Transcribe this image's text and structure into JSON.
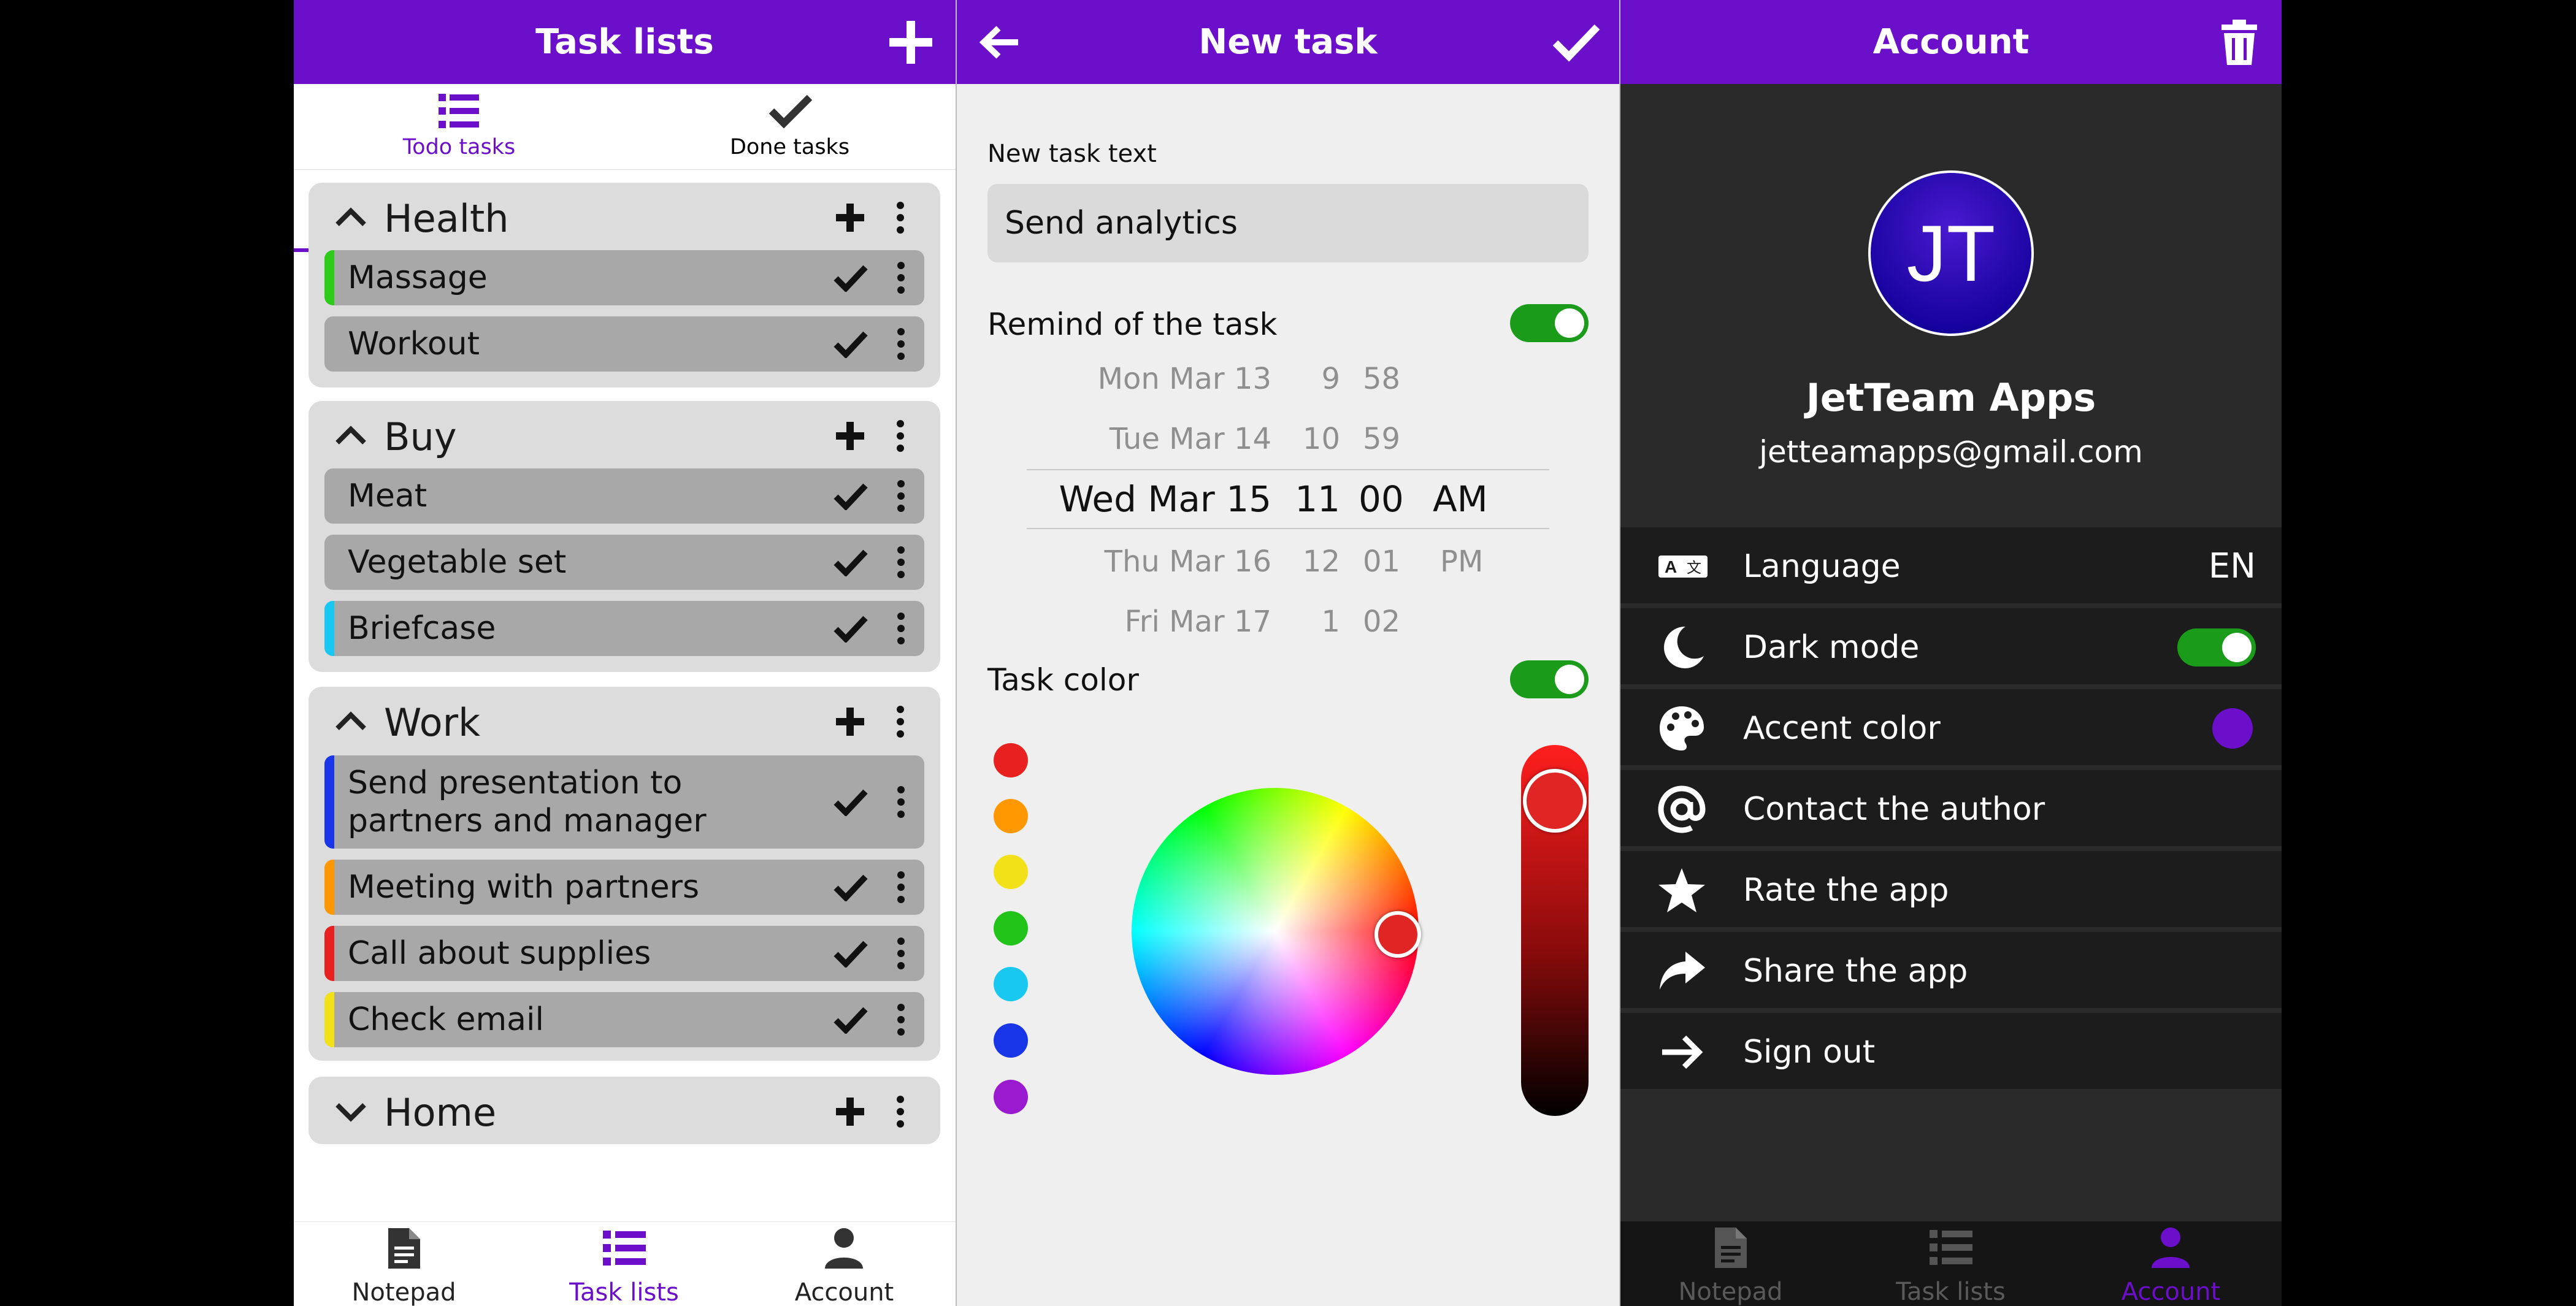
{
  "colors": {
    "accent": "#6b0fca",
    "toggle_on": "#1a9c1a",
    "task_bg": "#a8a8a8",
    "group_bg": "#dcdcdc",
    "dark_bg": "#2a2a2a"
  },
  "task_lists": {
    "title": "Task lists",
    "tabs": [
      {
        "label": "Todo tasks",
        "active": true
      },
      {
        "label": "Done tasks",
        "active": false
      }
    ],
    "groups": [
      {
        "title": "Health",
        "expanded": true,
        "tasks": [
          {
            "text": "Massage",
            "color": "#2ecc1a"
          },
          {
            "text": "Workout",
            "color": ""
          }
        ]
      },
      {
        "title": "Buy",
        "expanded": true,
        "tasks": [
          {
            "text": "Meat",
            "color": ""
          },
          {
            "text": "Vegetable set",
            "color": ""
          },
          {
            "text": "Briefcase",
            "color": "#18c8f0"
          }
        ]
      },
      {
        "title": "Work",
        "expanded": true,
        "tasks": [
          {
            "text": "Send presentation to partners and manager",
            "color": "#1836e8"
          },
          {
            "text": "Meeting with partners",
            "color": "#ff9800"
          },
          {
            "text": "Call about supplies",
            "color": "#e82020"
          },
          {
            "text": "Check email",
            "color": "#f2e118"
          }
        ]
      },
      {
        "title": "Home",
        "expanded": false,
        "tasks": []
      }
    ],
    "bottom_nav": [
      {
        "label": "Notepad",
        "icon": "document-icon",
        "active": false
      },
      {
        "label": "Task lists",
        "icon": "list-icon",
        "active": true
      },
      {
        "label": "Account",
        "icon": "person-icon",
        "active": false
      }
    ]
  },
  "new_task": {
    "title": "New task",
    "field_label": "New task text",
    "field_value": "Send analytics",
    "remind_label": "Remind of the task",
    "remind_on": true,
    "picker": {
      "days": [
        "Mon Mar 13",
        "Tue Mar 14",
        "Wed Mar 15",
        "Thu Mar 16",
        "Fri Mar 17"
      ],
      "hours": [
        "9",
        "10",
        "11",
        "12",
        "1"
      ],
      "minutes": [
        "58",
        "59",
        "00",
        "01",
        "02"
      ],
      "ampm": [
        "AM",
        "PM"
      ],
      "selected": {
        "day": "Wed Mar 15",
        "hour": "11",
        "minute": "00",
        "ampm": "AM"
      }
    },
    "color_label": "Task color",
    "color_on": true,
    "swatches": [
      "#e82020",
      "#ff9800",
      "#f2e118",
      "#22c41a",
      "#18c8f0",
      "#1836e8",
      "#9a1ad0"
    ],
    "selected_color": "#e02525"
  },
  "account": {
    "title": "Account",
    "initials": "JT",
    "name": "JetTeam Apps",
    "email": "jetteamapps@gmail.com",
    "settings": [
      {
        "label": "Language",
        "icon": "translate-icon",
        "value": "EN"
      },
      {
        "label": "Dark mode",
        "icon": "moon-icon",
        "toggle": true
      },
      {
        "label": "Accent color",
        "icon": "palette-icon",
        "color": "#6b0fca"
      },
      {
        "label": "Contact the author",
        "icon": "at-icon"
      },
      {
        "label": "Rate the app",
        "icon": "star-icon"
      },
      {
        "label": "Share the app",
        "icon": "share-icon"
      },
      {
        "label": "Sign out",
        "icon": "sign-out-icon"
      }
    ],
    "bottom_nav": [
      {
        "label": "Notepad",
        "icon": "document-icon",
        "active": false
      },
      {
        "label": "Task lists",
        "icon": "list-icon",
        "active": false
      },
      {
        "label": "Account",
        "icon": "person-icon",
        "active": true
      }
    ]
  }
}
